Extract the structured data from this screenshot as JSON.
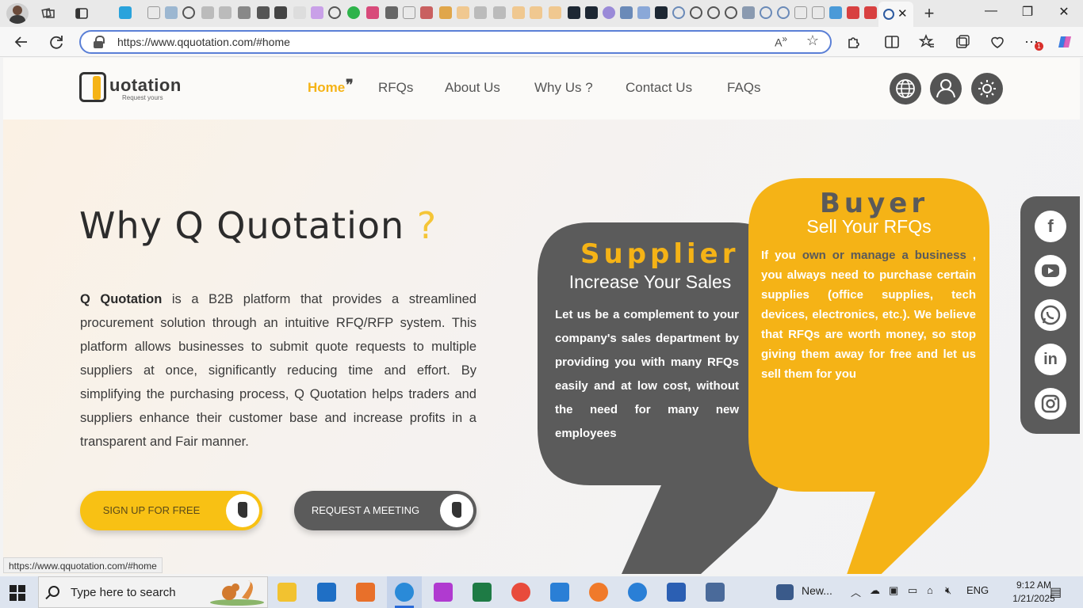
{
  "browser": {
    "url": "https://www.qquotation.com/#home",
    "status_url": "https://www.qquotation.com/#home",
    "notification_count": "1"
  },
  "site": {
    "logo_text": "uotation",
    "logo_tagline": "Request yours",
    "nav": {
      "home": "Home",
      "rfqs": "RFQs",
      "about": "About Us",
      "why": "Why Us ?",
      "contact": "Contact Us",
      "faqs": "FAQs"
    },
    "hero": {
      "title": "Why Q Quotation",
      "title_mark": "?",
      "brand": "Q Quotation",
      "body": " is a B2B platform that provides a streamlined procurement solution through an intuitive RFQ/RFP system. This platform allows businesses to submit quote requests to multiple suppliers at once, significantly reducing time and effort. By simplifying the purchasing process, Q Quotation helps traders and suppliers enhance their customer base and increase profits in a transparent and Fair manner.",
      "signup_label": "SIGN UP FOR FREE",
      "meeting_label": "REQUEST A MEETING"
    },
    "supplier": {
      "title": "Supplier",
      "subtitle": "Increase Your Sales",
      "body_a": "Let us be a complement to your company's sales department by providing you with many ",
      "body_strong": "RFQs",
      "body_b": " easily and at low cost, without the need for many new employees"
    },
    "buyer": {
      "title": "Buyer",
      "subtitle": "Sell Your RFQs",
      "body_1": "If you ",
      "body_2": "own or manage a business",
      "body_3": " , you always need to ",
      "body_4": "purchase certain supplies",
      "body_5": " (office supplies, tech devices, electronics, etc.). We believe that RFQs are worth money, so stop giving them away for free and let us sell them for you"
    },
    "colors": {
      "accent": "#f5b316",
      "dark": "#5b5b5b"
    }
  },
  "taskbar": {
    "search_placeholder": "Type here to search",
    "news_label": "New...",
    "language": "ENG",
    "time": "9:12 AM",
    "date": "1/21/2025"
  }
}
